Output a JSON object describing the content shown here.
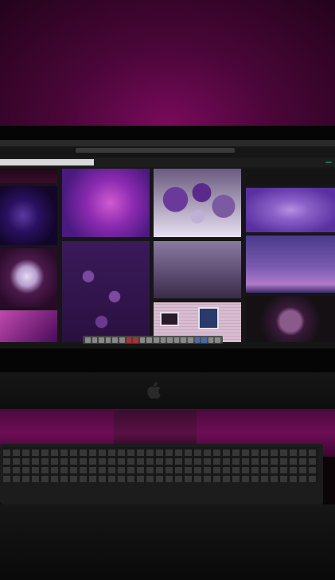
{
  "scene": {
    "description_colors": {
      "wall": "#5a0844",
      "glow": "#7a0a5c",
      "screen_bg": "#161616",
      "dock": "#4a4a4a"
    }
  },
  "screen": {
    "menubar": {
      "items": [
        "",
        "",
        "",
        "",
        ""
      ]
    },
    "search": {
      "placeholder": ""
    },
    "header": {
      "links": [
        "",
        ""
      ],
      "upload_label": ""
    },
    "gallery": {
      "tiles": [
        {
          "name": "dark-tile",
          "colors": [
            "#200818",
            "#3a0c2a"
          ]
        },
        {
          "name": "sparkle-tile",
          "colors": [
            "#3a1a6a",
            "#12062a"
          ]
        },
        {
          "name": "daisy-tile",
          "colors": [
            "#2a0a2a",
            "#d9c7e8"
          ]
        },
        {
          "name": "pink-gradient-tile",
          "colors": [
            "#b03a9e",
            "#4a0a5a"
          ]
        },
        {
          "name": "purple-flower-tile",
          "colors": [
            "#7a2aa0",
            "#c04ac0"
          ]
        },
        {
          "name": "lilac-cluster-tile",
          "colors": [
            "#3a1a5a",
            "#6a3a8a"
          ]
        },
        {
          "name": "balloons-tile",
          "colors": [
            "#6a4a8a",
            "#e8e0f0"
          ]
        },
        {
          "name": "allium-field-tile",
          "colors": [
            "#5a4a6a",
            "#8a7aa0"
          ]
        },
        {
          "name": "window-wall-tile",
          "colors": [
            "#d0b0c8",
            "#e8d4e0"
          ]
        },
        {
          "name": "water-ripple-tile",
          "colors": [
            "#6a40b0",
            "#9a70d0"
          ]
        },
        {
          "name": "sky-birds-tile",
          "colors": [
            "#7a5ab0",
            "#3a2a6a"
          ]
        },
        {
          "name": "allium-dark-tile",
          "colors": [
            "#1a0a1a",
            "#7a4a7a"
          ]
        }
      ]
    },
    "dock": {
      "icon_count": 22
    }
  }
}
